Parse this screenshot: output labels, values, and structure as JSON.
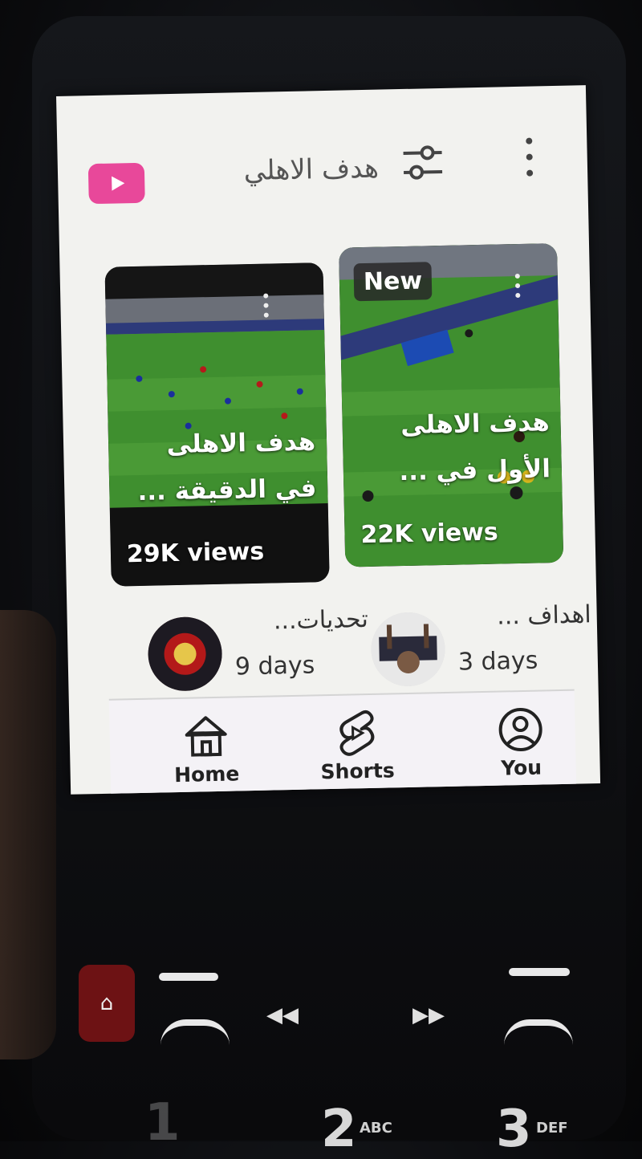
{
  "app": {
    "search_query": "هدف الاهلي"
  },
  "shorts": [
    {
      "title_line1": "هدف الاهلى",
      "title_line2": "في الدقيقة ...",
      "views": "29K views",
      "badge": ""
    },
    {
      "title_line1": "هدف الاهلى",
      "title_line2": "الأول في ...",
      "views": "22K views",
      "badge": "New"
    }
  ],
  "channels": [
    {
      "title": "تحديات...",
      "age": "9 days"
    },
    {
      "title": "اهداف ...",
      "age": "3 days"
    }
  ],
  "nav": {
    "home": "Home",
    "shorts": "Shorts",
    "you": "You"
  },
  "keypad": {
    "key2_digit": "2",
    "key2_letters": "ABC",
    "key3_digit": "3",
    "key3_letters": "DEF",
    "key1_digit": "1"
  },
  "colors": {
    "logo": "#e8489a",
    "screen_bg": "#f2f2ef",
    "pitch": "#3f8f2f"
  },
  "icons": [
    "youtube-logo-icon",
    "filter-icon",
    "more-vertical-icon",
    "home-icon",
    "shorts-icon",
    "account-icon"
  ]
}
